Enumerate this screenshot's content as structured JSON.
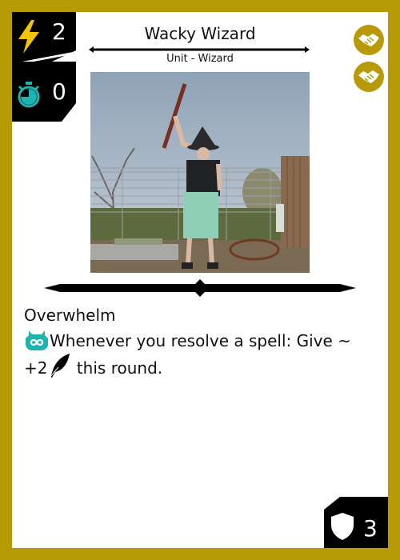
{
  "card": {
    "name": "Wacky Wizard",
    "type_line": "Unit - Wizard",
    "cost": "2",
    "delay": "0",
    "defense": "3",
    "frame_color": "#b89a06",
    "accent_color": "#1fb3b0",
    "icons": {
      "cost": "lightning-bolt-icon",
      "delay": "stopwatch-icon",
      "ally": "handshake-icon",
      "trigger": "infinity-owl-icon",
      "attack": "feather-quill-icon",
      "defense": "shield-icon"
    }
  },
  "ability": {
    "name": "Overwhelm",
    "text_before_icon": "Whenever you resolve a spell: Give ~ +2",
    "text_after_icon": " this round."
  }
}
